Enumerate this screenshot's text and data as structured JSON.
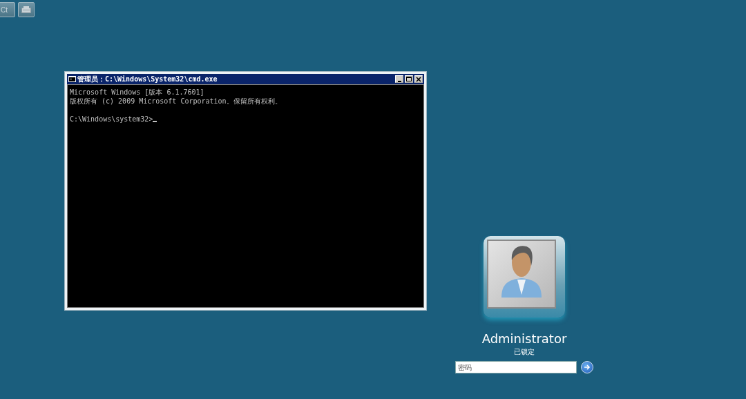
{
  "top_buttons": [
    {
      "kind": "text",
      "label": "Ct"
    },
    {
      "kind": "icon"
    }
  ],
  "console_window": {
    "title": "管理员：C:\\Windows\\System32\\cmd.exe",
    "lines": [
      "Microsoft Windows [版本 6.1.7601]",
      "版权所有 (c) 2009 Microsoft Corporation。保留所有权利。"
    ],
    "prompt": "C:\\Windows\\system32>"
  },
  "login": {
    "user_name": "Administrator",
    "status": "已锁定",
    "password": {
      "placeholder": "密码"
    }
  }
}
